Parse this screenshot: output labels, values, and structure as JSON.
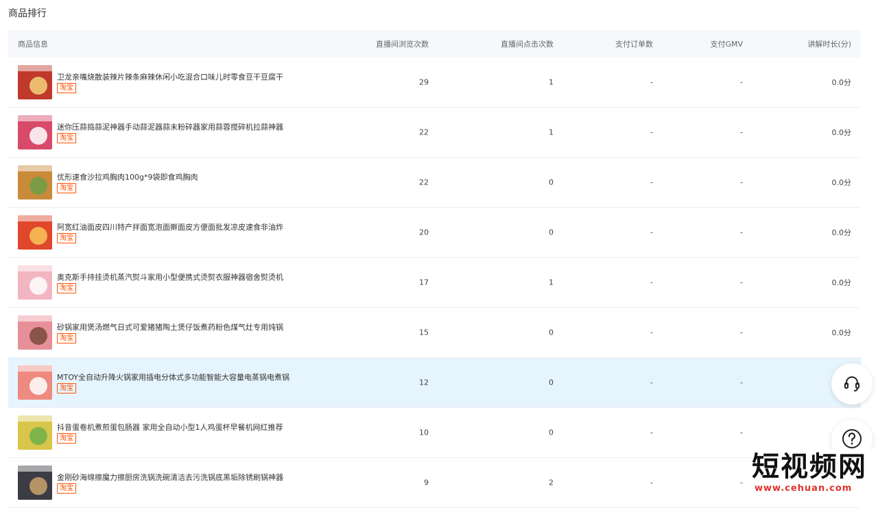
{
  "section_title": "商品排行",
  "columns": [
    "商品信息",
    "直播间浏览次数",
    "直播间点击次数",
    "支付订单数",
    "支付GMV",
    "讲解时长(分)"
  ],
  "rows": [
    {
      "name": "卫龙亲嘴烧散装辣片辣条麻辣休闲小吃混合口味儿时零食豆干豆腐干",
      "tag": "淘宝",
      "views": "29",
      "clicks": "1",
      "orders": "-",
      "gmv": "-",
      "duration": "0.0分"
    },
    {
      "name": "迷你压蒜捣蒜泥神器手动蒜泥器蒜末粉碎器家用蒜蓉搅碎机拉蒜神器",
      "tag": "淘宝",
      "views": "22",
      "clicks": "1",
      "orders": "-",
      "gmv": "-",
      "duration": "0.0分"
    },
    {
      "name": "优形速食沙拉鸡胸肉100g*9袋即食鸡胸肉",
      "tag": "淘宝",
      "views": "22",
      "clicks": "0",
      "orders": "-",
      "gmv": "-",
      "duration": "0.0分"
    },
    {
      "name": "阿宽红油面皮四川特产拌面宽泡面擀面皮方便面批发凉皮速食非油炸",
      "tag": "淘宝",
      "views": "20",
      "clicks": "0",
      "orders": "-",
      "gmv": "-",
      "duration": "0.0分"
    },
    {
      "name": "奥克斯手持挂烫机蒸汽熨斗家用小型便携式烫熨衣服神器宿舍熨烫机",
      "tag": "淘宝",
      "views": "17",
      "clicks": "1",
      "orders": "-",
      "gmv": "-",
      "duration": "0.0分"
    },
    {
      "name": "砂锅家用煲汤燃气日式可爱猪猪陶土煲仔饭煮药粉色煤气灶专用炖锅",
      "tag": "淘宝",
      "views": "15",
      "clicks": "0",
      "orders": "-",
      "gmv": "-",
      "duration": "0.0分"
    },
    {
      "name": "MTOY全自动升降火锅家用插电分体式多功能智能大容量电蒸锅电煮锅",
      "tag": "淘宝",
      "views": "12",
      "clicks": "0",
      "orders": "-",
      "gmv": "-",
      "duration": ""
    },
    {
      "name": "抖音蛋卷机煮煎蛋包肠器 家用全自动小型1人鸡蛋杯早餐机网红推荐",
      "tag": "淘宝",
      "views": "10",
      "clicks": "0",
      "orders": "-",
      "gmv": "-",
      "duration": ""
    },
    {
      "name": "金刚砂海绵擦魔力擦厨房洗锅洗碗清洁去污洗锅底黑垢除锈刷锅神器",
      "tag": "淘宝",
      "views": "9",
      "clicks": "2",
      "orders": "-",
      "gmv": "-",
      "duration": ""
    }
  ],
  "thumb_colors": [
    "#c0392b",
    "#d84a6a",
    "#c98b3a",
    "#e0472b",
    "#f2b6c0",
    "#e8909a",
    "#ef8a80",
    "#d9c54a",
    "#3c3c44"
  ],
  "thumb_accents": [
    "#f4d27a",
    "#ffffff",
    "#6d9e46",
    "#f7c55a",
    "#ffffff",
    "#7a4a3a",
    "#ffffff",
    "#6fb04a",
    "#c9a36b"
  ],
  "icons": {
    "service": "headset-icon",
    "help": "question-circle-icon"
  },
  "watermark": {
    "main": "短视频网",
    "sub": "www.cehuan.com"
  },
  "accent_color": "#ff5000",
  "highlight_row_index": 6
}
